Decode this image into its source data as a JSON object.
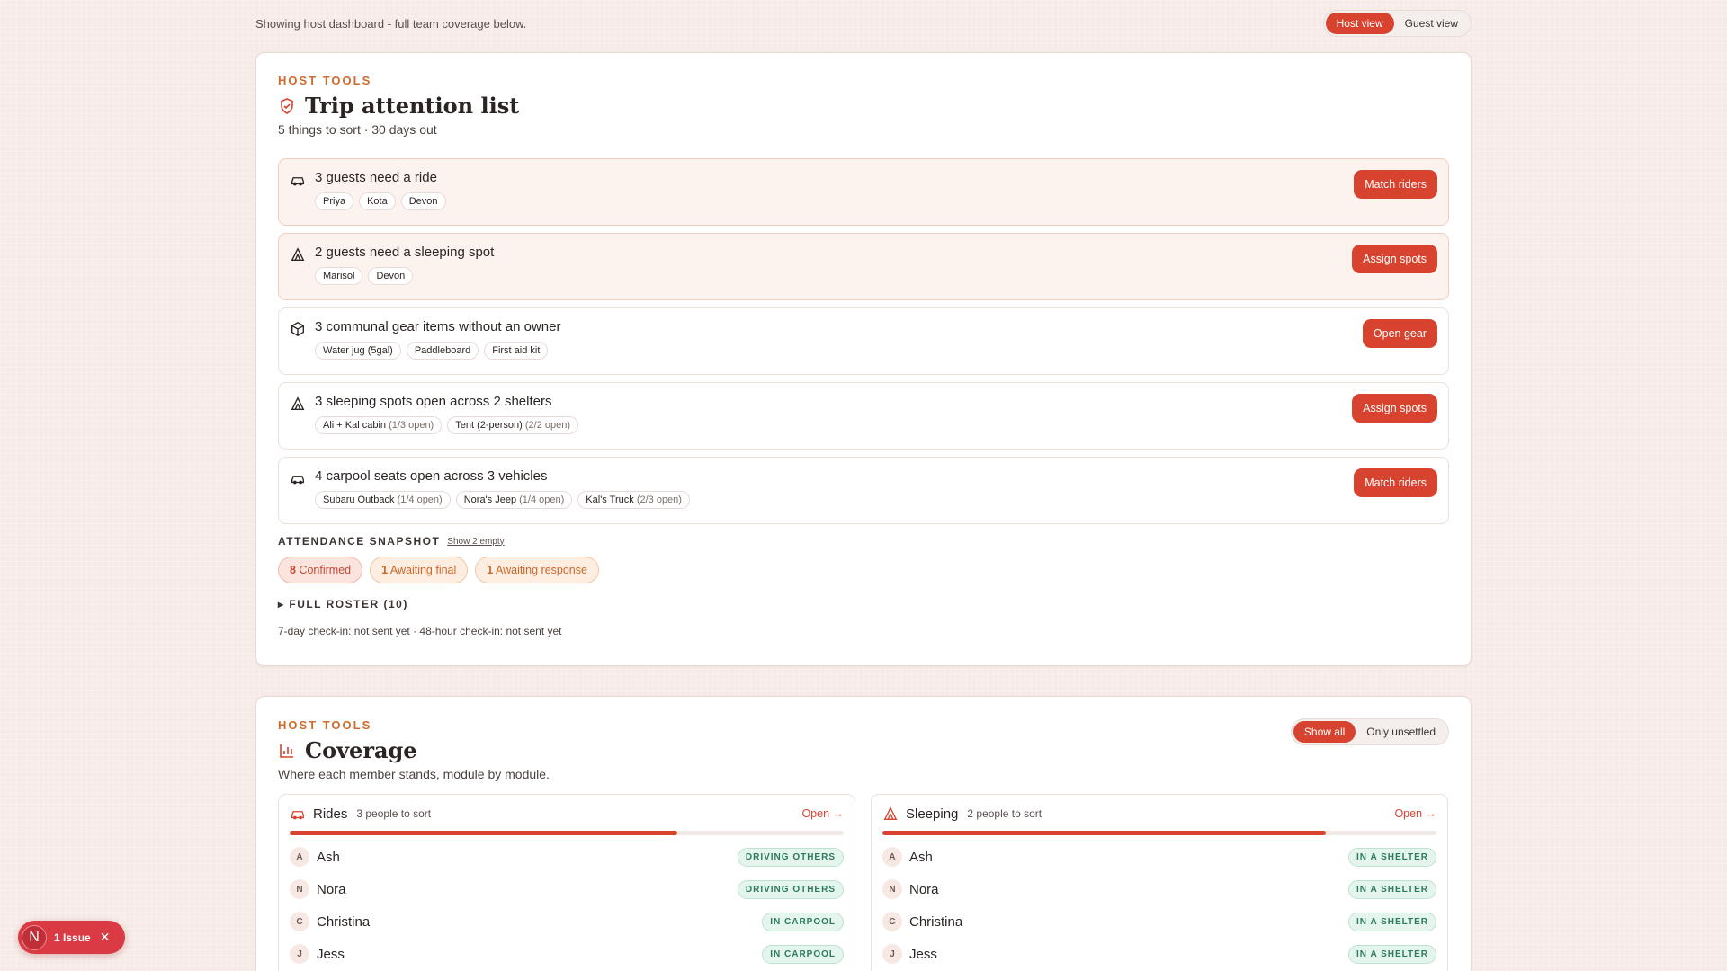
{
  "topbar": {
    "note": "Showing host dashboard - full team coverage below.",
    "views": [
      "Host view",
      "Guest view"
    ]
  },
  "attention": {
    "eyebrow": "HOST TOOLS",
    "title": "Trip attention list",
    "subtitle": "5 things to sort · 30 days out",
    "items": [
      {
        "icon": "car-icon",
        "text": "3 guests need a ride",
        "chips": [
          [
            "Priya",
            ""
          ],
          [
            "Kota",
            ""
          ],
          [
            "Devon",
            ""
          ]
        ],
        "action": "Match riders"
      },
      {
        "icon": "tent-icon",
        "text": "2 guests need a sleeping spot",
        "chips": [
          [
            "Marisol",
            ""
          ],
          [
            "Devon",
            ""
          ]
        ],
        "action": "Assign spots"
      },
      {
        "icon": "box-icon",
        "text": "3 communal gear items without an owner",
        "chips": [
          [
            "Water jug (5gal)",
            ""
          ],
          [
            "Paddleboard",
            ""
          ],
          [
            "First aid kit",
            ""
          ]
        ],
        "action": "Open gear"
      },
      {
        "icon": "tent-icon",
        "text": "3 sleeping spots open across 2 shelters",
        "chips": [
          [
            "Ali + Kal cabin",
            "(1/3 open)"
          ],
          [
            "Tent (2-person)",
            "(2/2 open)"
          ]
        ],
        "action": "Assign spots"
      },
      {
        "icon": "car-icon",
        "text": "4 carpool seats open across 3 vehicles",
        "chips": [
          [
            "Subaru Outback",
            "(1/4 open)"
          ],
          [
            "Nora's Jeep",
            "(1/4 open)"
          ],
          [
            "Kal's Truck",
            "(2/3 open)"
          ]
        ],
        "action": "Match riders"
      }
    ],
    "snapshot_label": "ATTENDANCE SNAPSHOT",
    "show_empty": "Show 2 empty",
    "pills": [
      {
        "count": "8",
        "label": "Confirmed"
      },
      {
        "count": "1",
        "label": "Awaiting final"
      },
      {
        "count": "1",
        "label": "Awaiting response"
      }
    ],
    "roster": "▸ FULL ROSTER (10)",
    "footer": "7-day check-in: not sent yet · 48-hour check-in: not sent yet"
  },
  "coverage": {
    "eyebrow": "HOST TOOLS",
    "title": "Coverage",
    "subtitle": "Where each member stands, module by module.",
    "filters": [
      "Show all",
      "Only unsettled"
    ],
    "modules": [
      {
        "name": "Rides",
        "count": "3 people to sort",
        "open": "Open →",
        "progress": 0.7,
        "rows": [
          [
            "A",
            "Ash",
            "DRIVING OTHERS"
          ],
          [
            "N",
            "Nora",
            "DRIVING OTHERS"
          ],
          [
            "C",
            "Christina",
            "IN CARPOOL"
          ],
          [
            "J",
            "Jess",
            "IN CARPOOL"
          ]
        ]
      },
      {
        "name": "Sleeping",
        "count": "2 people to sort",
        "open": "Open →",
        "progress": 0.8,
        "rows": [
          [
            "A",
            "Ash",
            "IN A SHELTER"
          ],
          [
            "N",
            "Nora",
            "IN A SHELTER"
          ],
          [
            "C",
            "Christina",
            "IN A SHELTER"
          ],
          [
            "J",
            "Jess",
            "IN A SHELTER"
          ]
        ]
      }
    ]
  },
  "toast": {
    "avatar": "N",
    "label": "1 Issue",
    "close": "✕"
  },
  "colors": {
    "accent": "#d8432f",
    "success": "#2e7a5c",
    "warning": "#c9682a"
  }
}
